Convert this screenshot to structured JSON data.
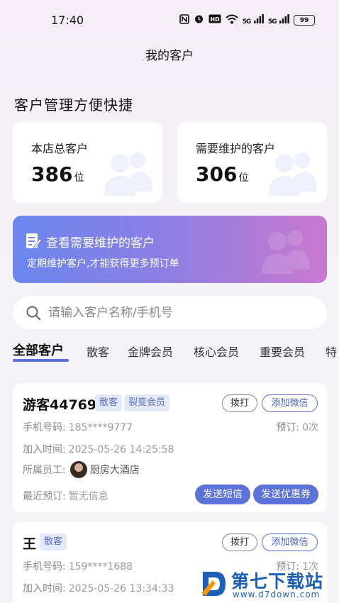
{
  "status_bar": {
    "time": "17:40",
    "icons": [
      "nfc-icon",
      "alarm-icon",
      "hd-icon",
      "wifi-icon",
      "signal-5g-icon",
      "signal-5g-icon"
    ],
    "network_label_1": "5G",
    "network_label_2": "5G",
    "hd_label": "HD",
    "battery": "99"
  },
  "header": {
    "title": "我的客户"
  },
  "section_title": "客户管理方便快捷",
  "stats": {
    "total": {
      "label": "本店总客户",
      "value": "386",
      "unit": "位"
    },
    "maintain": {
      "label": "需要维护的客户",
      "value": "306",
      "unit": "位"
    }
  },
  "promo": {
    "title": "查看需要维护的客户",
    "subtitle": "定期维护客户,才能获得更多预订单"
  },
  "search": {
    "placeholder": "请输入客户名称/手机号"
  },
  "tabs": [
    "全部客户",
    "散客",
    "金牌会员",
    "核心会员",
    "重要会员",
    "特"
  ],
  "active_tab_index": 0,
  "customers": [
    {
      "name": "游客44769",
      "tags": [
        "散客",
        "裂变会员"
      ],
      "call_label": "拨打",
      "wechat_label": "添加微信",
      "phone_label": "手机号码:",
      "phone": "185****9777",
      "booking_label": "预订:",
      "booking_count": "0次",
      "join_label": "加入时间:",
      "join_time": "2025-05-26 14:25:58",
      "employee_label": "所属员工:",
      "employee_name": "厨房大酒店",
      "recent_label": "最近预订:",
      "recent_value": "暂无信息",
      "sms_label": "发送短信",
      "coupon_label": "发送优惠券"
    },
    {
      "name": "王",
      "tags": [
        "散客"
      ],
      "call_label": "拨打",
      "wechat_label": "添加微信",
      "phone_label": "手机号码:",
      "phone": "159****1688",
      "booking_label": "预订:",
      "booking_count": "1次",
      "join_label": "加入时间:",
      "join_time": "2025-05-26 13:34:33"
    }
  ],
  "watermark": {
    "title": "第七下载站",
    "url": "www.d7down.com"
  },
  "colors": {
    "accent": "#5b73d9",
    "promo_start": "#6b86ee",
    "promo_end": "#c979cf",
    "tag_bg": "#e4e9fa",
    "watermark": "#1d5fb8"
  }
}
